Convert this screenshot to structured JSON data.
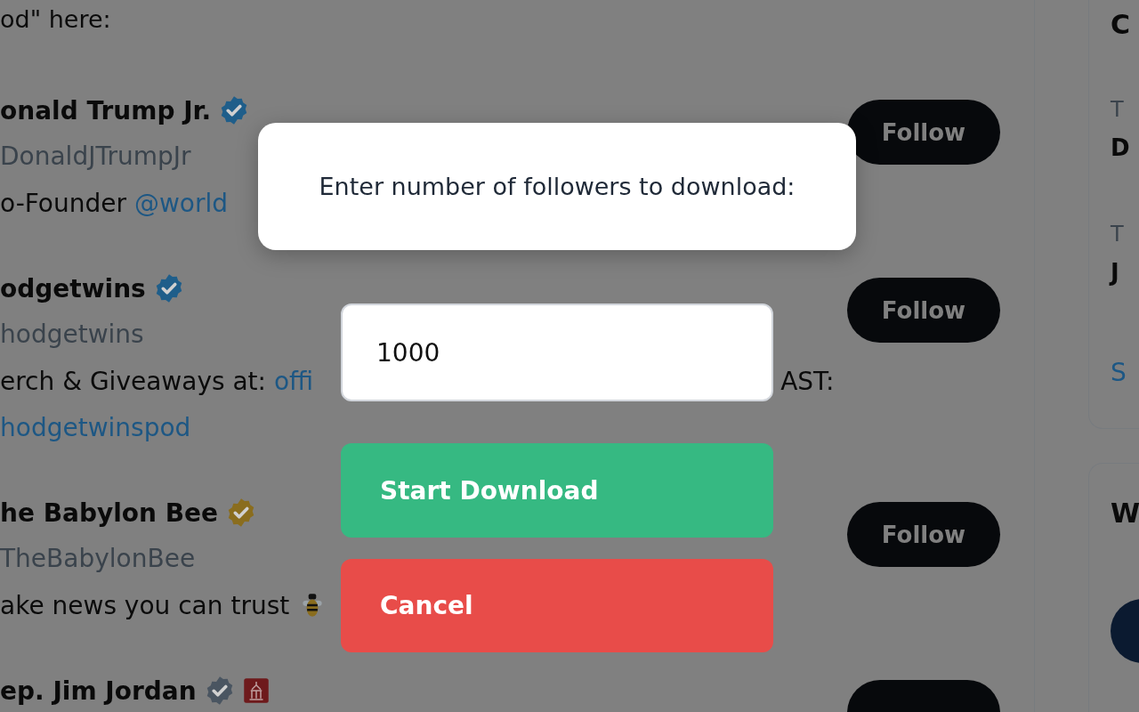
{
  "feed": {
    "intro": "od\" here:",
    "users": [
      {
        "name": "onald Trump Jr.",
        "badge": {
          "color": "#1f5e8a"
        },
        "handle": "DonaldJTrumpJr",
        "bio": [
          {
            "kind": "text",
            "text": "o-Founder "
          },
          {
            "kind": "link",
            "text": "@world"
          }
        ],
        "follow": "Follow"
      },
      {
        "name": "odgetwins",
        "badge": {
          "color": "#1f5e8a"
        },
        "handle": "hodgetwins",
        "bio": [
          {
            "kind": "text",
            "text": "erch & Giveaways at: "
          },
          {
            "kind": "link",
            "text": "offi"
          },
          {
            "kind": "gap"
          },
          {
            "kind": "text",
            "text": "AST:"
          },
          {
            "kind": "break"
          },
          {
            "kind": "link",
            "text": "hodgetwinspod"
          }
        ],
        "follow": "Follow"
      },
      {
        "name": "he Babylon Bee",
        "badge": {
          "color": "#8a6d1e"
        },
        "handle": "TheBabylonBee",
        "bio": [
          {
            "kind": "text",
            "text": "ake news you can trust "
          },
          {
            "kind": "bee"
          }
        ],
        "follow": "Follow"
      },
      {
        "name": "ep. Jim Jordan",
        "badge": {
          "color": "#4a5561"
        },
        "flag": true
      }
    ]
  },
  "sidebar": {
    "cards": [
      {
        "kind": "trends",
        "title": "C",
        "items": [
          {
            "label": "T",
            "value": "D"
          },
          {
            "label": "T",
            "value": "J"
          }
        ],
        "link": "S"
      },
      {
        "kind": "who_to_follow",
        "title": "W"
      }
    ]
  },
  "dialog": {
    "message": "Enter number of followers to download:",
    "input": {
      "value": "1000"
    },
    "buttons": [
      {
        "kind": "primary",
        "label": "Start Download"
      },
      {
        "kind": "danger",
        "label": "Cancel"
      }
    ]
  }
}
